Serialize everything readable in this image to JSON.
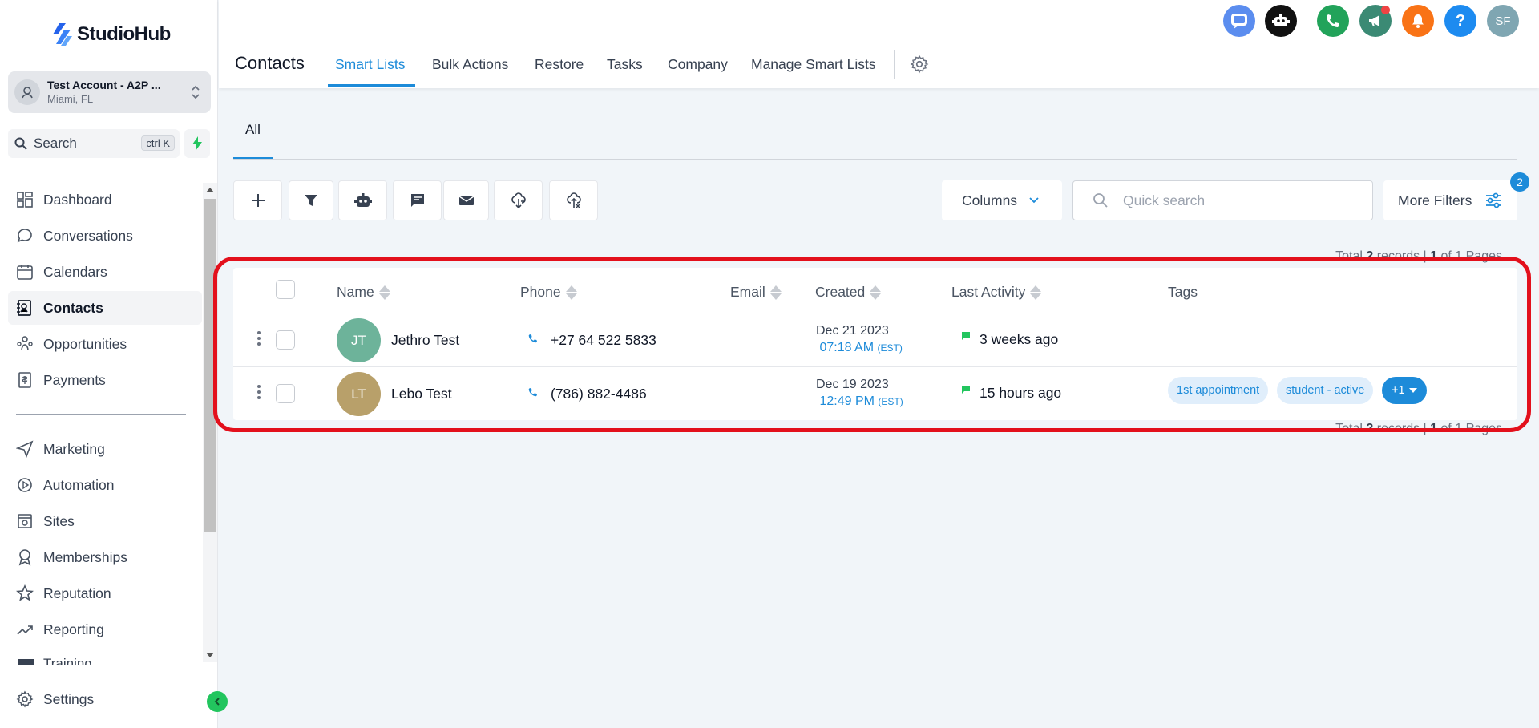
{
  "sidebar": {
    "logo": "StudioHub",
    "account": {
      "name": "Test Account - A2P ...",
      "location": "Miami, FL"
    },
    "search": {
      "label": "Search",
      "shortcut": "ctrl K"
    },
    "nav_top": [
      {
        "label": "Dashboard",
        "icon": "dashboard-icon"
      },
      {
        "label": "Conversations",
        "icon": "chat-bubble-icon"
      },
      {
        "label": "Calendars",
        "icon": "calendar-icon"
      },
      {
        "label": "Contacts",
        "icon": "contacts-icon",
        "active": true
      },
      {
        "label": "Opportunities",
        "icon": "opportunities-icon"
      },
      {
        "label": "Payments",
        "icon": "payments-icon"
      }
    ],
    "nav_bottom": [
      {
        "label": "Marketing",
        "icon": "send-icon"
      },
      {
        "label": "Automation",
        "icon": "automation-icon"
      },
      {
        "label": "Sites",
        "icon": "sites-icon"
      },
      {
        "label": "Memberships",
        "icon": "badge-icon"
      },
      {
        "label": "Reputation",
        "icon": "star-icon"
      },
      {
        "label": "Reporting",
        "icon": "trend-icon"
      }
    ],
    "partial_item": "Training",
    "settings": "Settings"
  },
  "header": {
    "title": "Contacts",
    "tabs": [
      {
        "label": "Smart Lists",
        "active": true
      },
      {
        "label": "Bulk Actions"
      },
      {
        "label": "Restore"
      },
      {
        "label": "Tasks"
      },
      {
        "label": "Company"
      },
      {
        "label": "Manage Smart Lists"
      }
    ],
    "user_initials": "SF",
    "top_icons": [
      "chat-widget-icon",
      "robot-icon",
      "phone-icon",
      "megaphone-icon",
      "bell-icon",
      "help-icon",
      "user-avatar"
    ]
  },
  "subtab": {
    "label": "All"
  },
  "toolbar": {
    "buttons": [
      "add-icon",
      "filter-icon",
      "robot-icon",
      "message-icon",
      "mail-icon",
      "import-icon",
      "export-icon"
    ],
    "columns_label": "Columns",
    "search_placeholder": "Quick search",
    "more_filters_label": "More Filters",
    "filter_count": "2"
  },
  "records": {
    "prefix": "Total ",
    "count": "2",
    "middle": " records | ",
    "page": "1",
    "suffix": " of 1 Pages"
  },
  "table": {
    "columns": [
      "Name",
      "Phone",
      "Email",
      "Created",
      "Last Activity",
      "Tags"
    ],
    "rows": [
      {
        "initials": "JT",
        "avatar_color": "#6db39a",
        "name": "Jethro Test",
        "phone": "+27 64 522 5833",
        "email": "",
        "created_date": "Dec 21 2023",
        "created_time": "07:18 AM",
        "created_tz": "(EST)",
        "last_activity": "3 weeks ago",
        "tags": []
      },
      {
        "initials": "LT",
        "avatar_color": "#b8a06a",
        "name": "Lebo Test",
        "phone": "(786) 882-4486",
        "email": "",
        "created_date": "Dec 19 2023",
        "created_time": "12:49 PM",
        "created_tz": "(EST)",
        "last_activity": "15 hours ago",
        "tags": [
          "1st appointment",
          "student - active"
        ],
        "more_tags": "+1"
      }
    ]
  },
  "colors": {
    "accent": "#1d8bd9",
    "highlight": "#e3101c",
    "activity_green": "#22c55e"
  }
}
